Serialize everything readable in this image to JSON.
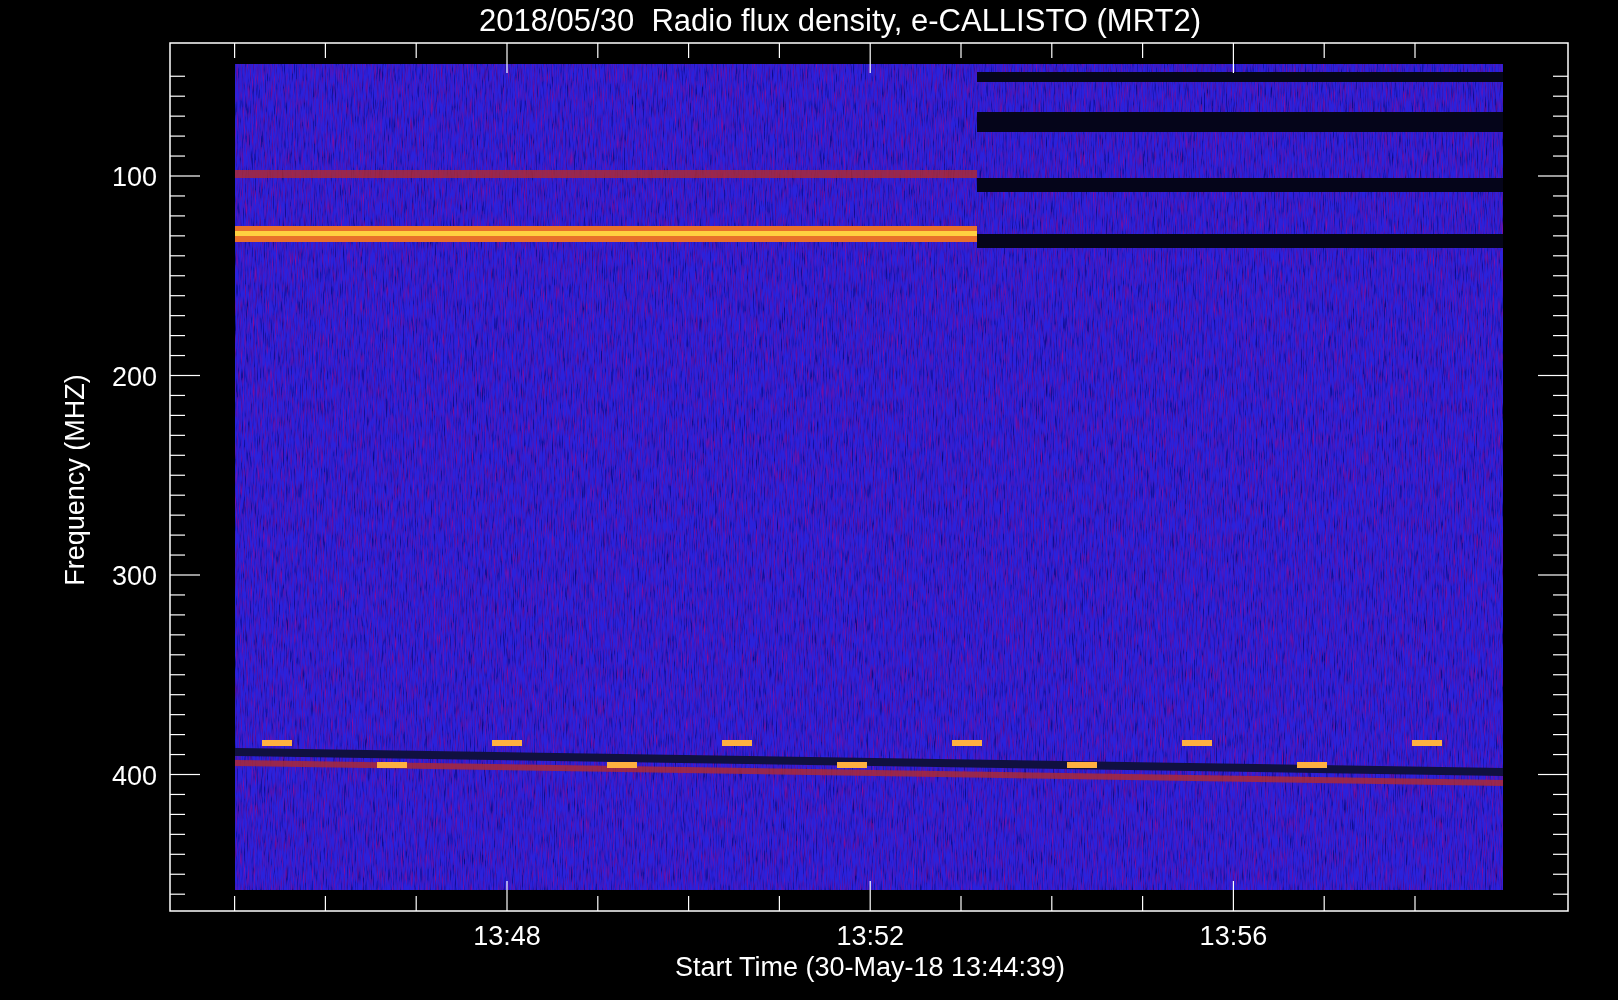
{
  "title": "2018/05/30  Radio flux density, e-CALLISTO (MRT2)",
  "y_axis": {
    "label": "Frequency (MHZ)",
    "ticks": [
      "100",
      "200",
      "300",
      "400"
    ]
  },
  "x_axis": {
    "label": "Start Time (30-May-18 13:44:39)",
    "ticks": [
      "13:48",
      "13:52",
      "13:56"
    ]
  }
}
